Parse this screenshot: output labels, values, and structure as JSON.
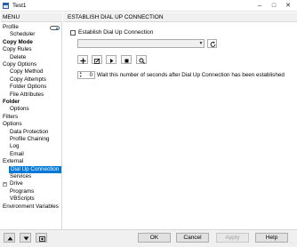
{
  "window": {
    "title": "Test1"
  },
  "sidebar": {
    "header": "MENU",
    "items": [
      {
        "label": "Profile",
        "level": 0,
        "bold": false
      },
      {
        "label": "Scheduler",
        "level": 1,
        "bold": false
      },
      {
        "label": "Copy Mode",
        "level": 0,
        "bold": true
      },
      {
        "label": "Copy Rules",
        "level": 0,
        "bold": false
      },
      {
        "label": "Delete",
        "level": 1,
        "bold": false
      },
      {
        "label": "Copy Options",
        "level": 0,
        "bold": false
      },
      {
        "label": "Copy Method",
        "level": 1,
        "bold": false
      },
      {
        "label": "Copy Attempts",
        "level": 1,
        "bold": false
      },
      {
        "label": "Folder Options",
        "level": 1,
        "bold": false
      },
      {
        "label": "File Attributes",
        "level": 1,
        "bold": false
      },
      {
        "label": "Folder",
        "level": 0,
        "bold": true
      },
      {
        "label": "Options",
        "level": 1,
        "bold": false
      },
      {
        "label": "Filters",
        "level": 0,
        "bold": false
      },
      {
        "label": "Options",
        "level": 0,
        "bold": false
      },
      {
        "label": "Data Protection",
        "level": 1,
        "bold": false
      },
      {
        "label": "Profile Chaining",
        "level": 1,
        "bold": false
      },
      {
        "label": "Log",
        "level": 1,
        "bold": false
      },
      {
        "label": "Email",
        "level": 1,
        "bold": false
      },
      {
        "label": "External",
        "level": 0,
        "bold": false
      },
      {
        "label": "Dial Up Connection",
        "level": 1,
        "bold": false,
        "selected": true
      },
      {
        "label": "Services",
        "level": 1,
        "bold": false
      },
      {
        "label": "Drive",
        "level": 1,
        "bold": false
      },
      {
        "label": "Programs",
        "level": 1,
        "bold": false
      },
      {
        "label": "VBScripts",
        "level": 1,
        "bold": false
      },
      {
        "label": "Environment Variables",
        "level": 0,
        "bold": false
      }
    ],
    "expander_symbol": "+"
  },
  "content": {
    "header": "ESTABLISH DIAL UP CONNECTION",
    "establish_checkbox_label": "Establish Dial Up Connection",
    "establish_checked": false,
    "connection_value": "",
    "wait_seconds": "0",
    "wait_label": "Wait this number of seconds after Dial Up Connection has been established"
  },
  "toolbar_icons": [
    "add-icon",
    "edit-icon",
    "run-icon",
    "stop-icon",
    "search-icon"
  ],
  "buttons": {
    "ok": "OK",
    "cancel": "Cancel",
    "apply": "Apply",
    "help": "Help"
  },
  "colors": {
    "selection": "#0078d7",
    "header_bg": "#f0f0f0"
  }
}
